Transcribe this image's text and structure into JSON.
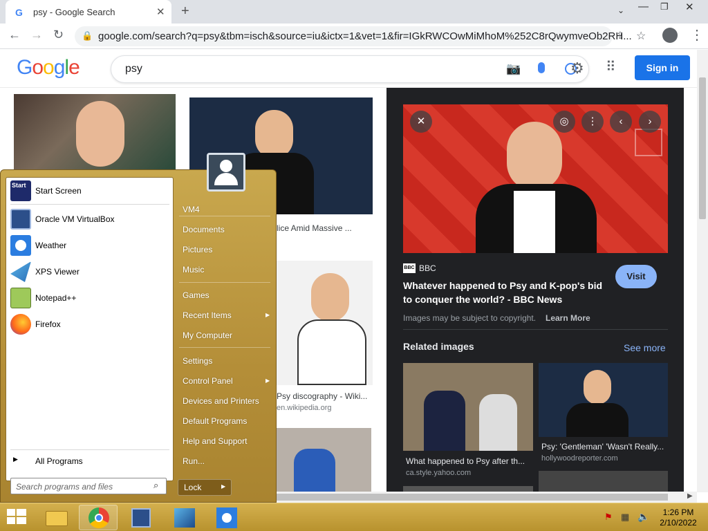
{
  "browser": {
    "tab_title": "psy - Google Search",
    "tab_favicon": "G",
    "url": "google.com/search?q=psy&tbm=isch&source=iu&ictx=1&vet=1&fir=IGkRWCOwMiMhoM%252C8rQwymveOb2RH..."
  },
  "google": {
    "logo": "Google",
    "query": "psy",
    "signin_label": "Sign in"
  },
  "results": {
    "item2_caption": "lice Amid Massive ...",
    "item5_caption": "Psy discography - Wiki...",
    "item5_source": "en.wikipedia.org"
  },
  "preview": {
    "source_name": "BBC",
    "source_badge": "BBC",
    "title_line1": "Whatever happened to Psy and K-pop's bid",
    "title_line2": "to conquer the world? - BBC News",
    "visit_label": "Visit",
    "copyright_text": "Images may be subject to copyright.",
    "learn_more": "Learn More",
    "related_heading": "Related images",
    "see_more": "See more",
    "related": [
      {
        "caption": "What happened to Psy after th...",
        "source": "ca.style.yahoo.com"
      },
      {
        "caption": "Psy: 'Gentleman' 'Wasn't Really...",
        "source": "hollywoodreporter.com"
      }
    ]
  },
  "startmenu": {
    "left_items": [
      {
        "label": "Start Screen",
        "icon": "start-screen-icon"
      },
      {
        "label": "Oracle VM VirtualBox",
        "icon": "virtualbox-icon"
      },
      {
        "label": "Weather",
        "icon": "weather-icon"
      },
      {
        "label": "XPS Viewer",
        "icon": "xps-viewer-icon"
      },
      {
        "label": "Notepad++",
        "icon": "notepadpp-icon"
      },
      {
        "label": "Firefox",
        "icon": "firefox-icon"
      }
    ],
    "all_programs": "All Programs",
    "search_placeholder": "Search programs and files",
    "right_items": [
      "VM4",
      "Documents",
      "Pictures",
      "Music",
      "Games",
      "Recent Items",
      "My Computer",
      "Settings",
      "Control Panel",
      "Devices and Printers",
      "Default Programs",
      "Help and Support",
      "Run..."
    ],
    "lock_label": "Lock",
    "start_tile_text": "Start"
  },
  "taskbar": {
    "time": "1:26 PM",
    "date": "2/10/2022"
  },
  "colors": {
    "google_blue": "#4285f4",
    "google_red": "#ea4335",
    "google_yellow": "#fbbc05",
    "google_green": "#34a853",
    "signin_blue": "#1a73e8",
    "startmenu_gold": "#c9a84e"
  }
}
